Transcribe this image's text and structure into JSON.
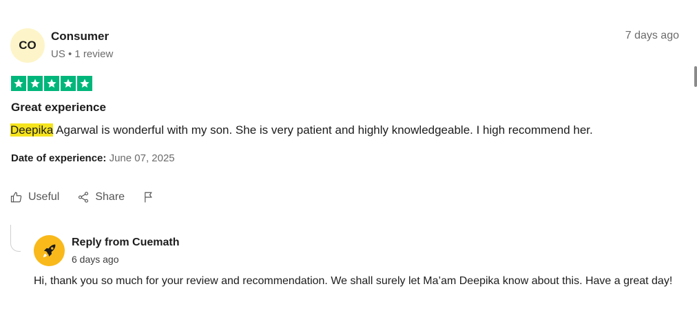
{
  "review": {
    "avatar_initials": "CO",
    "reviewer_name": "Consumer",
    "reviewer_meta": "US • 1 review",
    "posted": "7 days ago",
    "rating": 5,
    "star_color": "#00b67a",
    "title": "Great experience",
    "highlighted_word": "Deepika",
    "body_rest": " Agarwal is wonderful with my son. She is very patient and highly knowledgeable. I high recommend her.",
    "experience_label": "Date of experience:",
    "experience_date": "June 07, 2025"
  },
  "actions": {
    "useful": "Useful",
    "share": "Share",
    "flag_icon": "flag-icon"
  },
  "reply": {
    "from": "Reply from Cuemath",
    "posted": "6 days ago",
    "text": "Hi, thank you so much for your review and recommendation. We shall surely let Ma’am Deepika know about this. Have a great day!",
    "logo_color": "#f9b91a"
  }
}
